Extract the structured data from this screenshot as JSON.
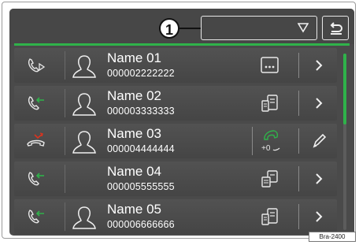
{
  "header": {
    "callout_number": "1",
    "dropdown_value": "",
    "dropdown_icon": "triangle-down-icon",
    "back_icon": "return-arrow-icon"
  },
  "contacts": [
    {
      "name": "Name 01",
      "number": "000002222222",
      "call_icon": "outgoing-call-icon",
      "action_icon": "more-dots-icon",
      "nav_icon": "chevron-right-icon"
    },
    {
      "name": "Name 02",
      "number": "000003333333",
      "call_icon": "incoming-call-icon",
      "action_icon": "contact-card-icon",
      "nav_icon": "chevron-right-icon"
    },
    {
      "name": "Name 03",
      "number": "000004444444",
      "call_icon": "missed-call-icon",
      "action_icon": "add-call-icon",
      "nav_icon": "pencil-edit-icon"
    },
    {
      "name": "Name 04",
      "number": "000005555555",
      "call_icon": "incoming-call-icon",
      "action_icon": "contact-card-icon",
      "nav_icon": "chevron-right-icon"
    },
    {
      "name": "Name 05",
      "number": "000006666666",
      "call_icon": "incoming-call-icon",
      "action_icon": "contact-card-icon",
      "nav_icon": "chevron-right-icon"
    }
  ],
  "add_call_label": "+0",
  "figure_code": "Bra-2400",
  "colors": {
    "accent_green": "#2fb24a",
    "missed_red": "#d9341f",
    "background": "#4a4a4a"
  }
}
